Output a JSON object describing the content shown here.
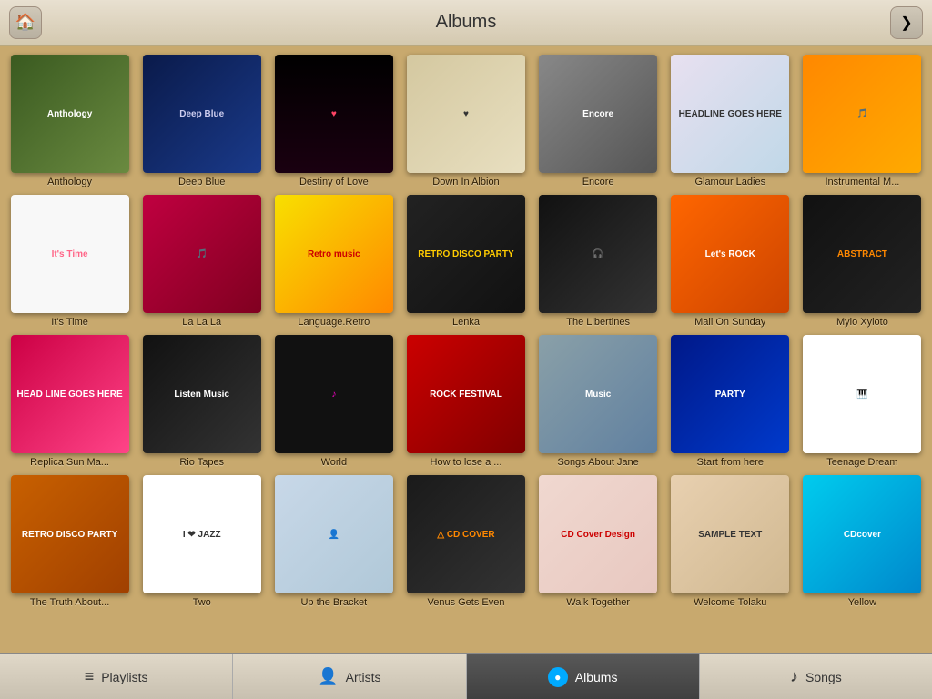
{
  "header": {
    "title": "Albums",
    "home_label": "🏠",
    "back_label": "❯"
  },
  "albums": [
    {
      "id": "anthology",
      "label": "Anthology",
      "cover_class": "cover-anthology",
      "text": "Anthology",
      "row": 1
    },
    {
      "id": "deepblue",
      "label": "Deep Blue",
      "cover_class": "cover-deepblue",
      "text": "Deep Blue",
      "row": 1
    },
    {
      "id": "destiny",
      "label": "Destiny of Love",
      "cover_class": "cover-destiny",
      "text": "♥",
      "row": 1
    },
    {
      "id": "downin",
      "label": "Down In Albion",
      "cover_class": "cover-downin",
      "text": "♥",
      "row": 1
    },
    {
      "id": "encore",
      "label": "Encore",
      "cover_class": "cover-encore",
      "text": "Encore",
      "row": 1
    },
    {
      "id": "glamour",
      "label": "Glamour Ladies",
      "cover_class": "cover-glamour",
      "text": "HEADLINE GOES HERE",
      "row": 1
    },
    {
      "id": "instrumental",
      "label": "Instrumental M...",
      "cover_class": "cover-instrumental",
      "text": "🎵",
      "row": 1
    },
    {
      "id": "itstime",
      "label": "It's Time",
      "cover_class": "cover-itstime",
      "text": "It's Time",
      "row": 2
    },
    {
      "id": "lalala",
      "label": "La La La",
      "cover_class": "cover-lalala",
      "text": "🎵",
      "row": 2
    },
    {
      "id": "language",
      "label": "Language.Retro",
      "cover_class": "cover-language",
      "text": "Retro music",
      "row": 2
    },
    {
      "id": "lenka",
      "label": "Lenka",
      "cover_class": "cover-lenka",
      "text": "RETRO DISCO PARTY",
      "row": 2
    },
    {
      "id": "libertines",
      "label": "The Libertines",
      "cover_class": "cover-libertines",
      "text": "🎧",
      "row": 2
    },
    {
      "id": "mailsunday",
      "label": "Mail On Sunday",
      "cover_class": "cover-mailsunday",
      "text": "Let's ROCK",
      "row": 2
    },
    {
      "id": "mylo",
      "label": "Mylo Xyloto",
      "cover_class": "cover-mylo",
      "text": "ABSTRACT",
      "row": 2
    },
    {
      "id": "replica",
      "label": "Replica Sun Ma...",
      "cover_class": "cover-replica",
      "text": "HEAD LINE GOES HERE",
      "row": 3
    },
    {
      "id": "riotapes",
      "label": "Rio Tapes",
      "cover_class": "cover-riotapes",
      "text": "Listen Music",
      "row": 3
    },
    {
      "id": "world",
      "label": "World",
      "cover_class": "cover-world",
      "text": "♪",
      "row": 3
    },
    {
      "id": "howtol",
      "label": "How to lose a ...",
      "cover_class": "cover-howtol",
      "text": "ROCK FESTIVAL",
      "row": 3
    },
    {
      "id": "songs",
      "label": "Songs About Jane",
      "cover_class": "cover-songs",
      "text": "Music",
      "row": 3
    },
    {
      "id": "startfrom",
      "label": "Start from here",
      "cover_class": "cover-startfrom",
      "text": "PARTY",
      "row": 3
    },
    {
      "id": "teenage",
      "label": "Teenage Dream",
      "cover_class": "cover-teenage",
      "text": "🎹",
      "row": 3
    },
    {
      "id": "truth",
      "label": "The Truth About...",
      "cover_class": "cover-truth",
      "text": "RETRO DISCO PARTY",
      "row": 4
    },
    {
      "id": "two",
      "label": "Two",
      "cover_class": "cover-two",
      "text": "I ❤ JAZZ",
      "row": 4
    },
    {
      "id": "upbracket",
      "label": "Up the Bracket",
      "cover_class": "cover-upbracket",
      "text": "👤",
      "row": 4
    },
    {
      "id": "venus",
      "label": "Venus Gets Even",
      "cover_class": "cover-venus",
      "text": "△ CD COVER",
      "row": 4
    },
    {
      "id": "walk",
      "label": "Walk Together",
      "cover_class": "cover-walk",
      "text": "CD Cover Design",
      "row": 4
    },
    {
      "id": "welcome",
      "label": "Welcome Tolaku",
      "cover_class": "cover-welcome",
      "text": "SAMPLE TEXT",
      "row": 4
    },
    {
      "id": "yellow",
      "label": "Yellow",
      "cover_class": "cover-yellow",
      "text": "CDcover",
      "row": 4
    }
  ],
  "nav": {
    "items": [
      {
        "id": "playlists",
        "label": "Playlists",
        "icon": "☰",
        "active": false
      },
      {
        "id": "artists",
        "label": "Artists",
        "icon": "👤",
        "active": false
      },
      {
        "id": "albums",
        "label": "Albums",
        "icon": "●",
        "active": true
      },
      {
        "id": "songs",
        "label": "Songs",
        "icon": "♪",
        "active": false
      }
    ]
  }
}
